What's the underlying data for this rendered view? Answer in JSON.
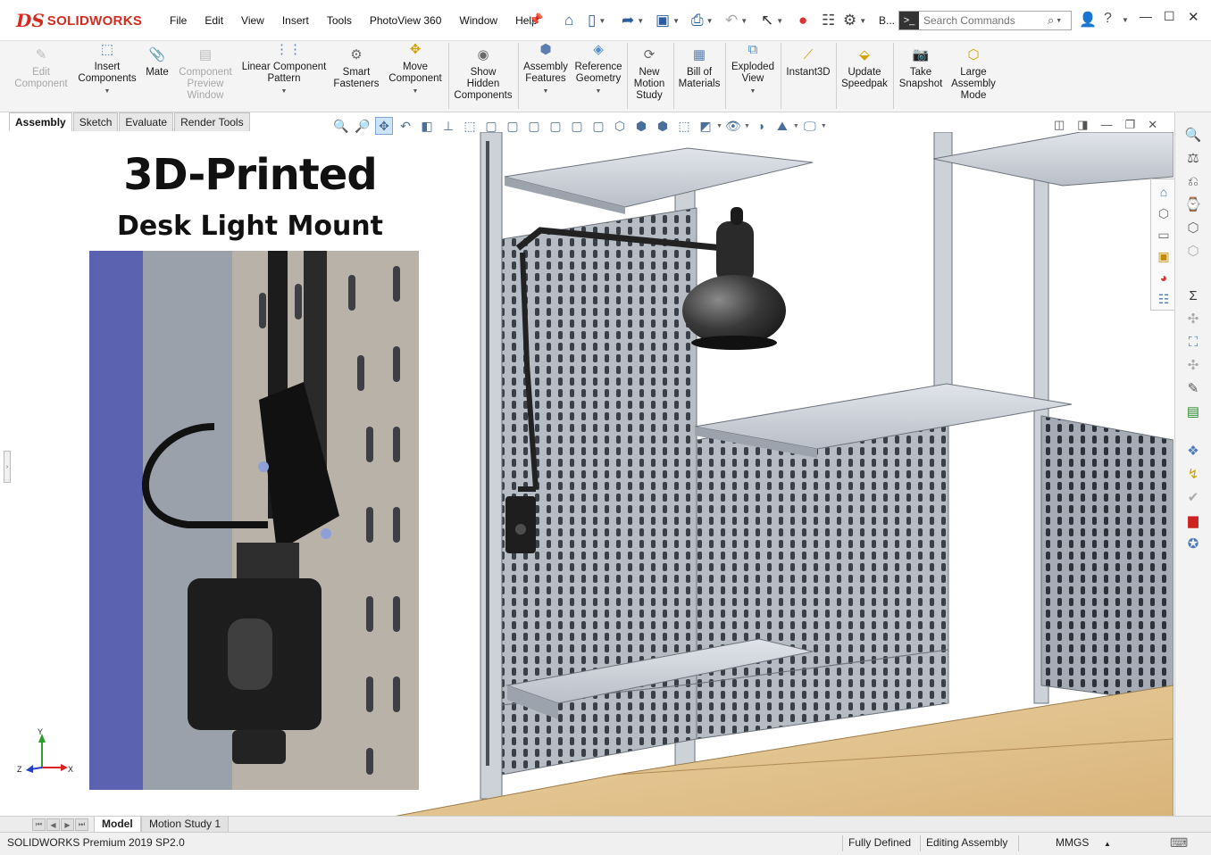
{
  "app": {
    "brand_ds": "DS",
    "brand_name": "SOLIDWORKS"
  },
  "menu": [
    "File",
    "Edit",
    "View",
    "Insert",
    "Tools",
    "PhotoView 360",
    "Window",
    "Help"
  ],
  "quick_access": {
    "overflow_label": "B...",
    "icons": [
      "home-icon",
      "new-document-icon",
      "open-icon",
      "save-icon",
      "print-icon",
      "undo-icon",
      "select-icon",
      "rebuild-icon",
      "file-properties-icon",
      "options-icon"
    ]
  },
  "search": {
    "placeholder": "Search Commands"
  },
  "ribbon": {
    "commands": [
      {
        "id": "edit-component",
        "label": [
          "Edit",
          "Component"
        ],
        "enabled": false,
        "dropdown": false
      },
      {
        "id": "insert-components",
        "label": [
          "Insert",
          "Components"
        ],
        "enabled": true,
        "dropdown": true
      },
      {
        "id": "mate",
        "label": [
          "Mate"
        ],
        "enabled": true,
        "dropdown": false
      },
      {
        "id": "component-preview-window",
        "label": [
          "Component",
          "Preview",
          "Window"
        ],
        "enabled": false,
        "dropdown": false
      },
      {
        "id": "linear-component-pattern",
        "label": [
          "Linear Component",
          "Pattern"
        ],
        "enabled": true,
        "dropdown": true
      },
      {
        "id": "smart-fasteners",
        "label": [
          "Smart",
          "Fasteners"
        ],
        "enabled": true,
        "dropdown": false
      },
      {
        "id": "move-component",
        "label": [
          "Move",
          "Component"
        ],
        "enabled": true,
        "dropdown": true
      },
      {
        "id": "show-hidden-components",
        "label": [
          "Show",
          "Hidden",
          "Components"
        ],
        "enabled": true,
        "dropdown": false
      },
      {
        "id": "assembly-features",
        "label": [
          "Assembly",
          "Features"
        ],
        "enabled": true,
        "dropdown": true
      },
      {
        "id": "reference-geometry",
        "label": [
          "Reference",
          "Geometry"
        ],
        "enabled": true,
        "dropdown": true
      },
      {
        "id": "new-motion-study",
        "label": [
          "New",
          "Motion",
          "Study"
        ],
        "enabled": true,
        "dropdown": false
      },
      {
        "id": "bill-of-materials",
        "label": [
          "Bill of",
          "Materials"
        ],
        "enabled": true,
        "dropdown": false
      },
      {
        "id": "exploded-view",
        "label": [
          "Exploded",
          "View"
        ],
        "enabled": true,
        "dropdown": true
      },
      {
        "id": "instant3d",
        "label": [
          "Instant3D"
        ],
        "enabled": true,
        "dropdown": false
      },
      {
        "id": "update-speedpak",
        "label": [
          "Update",
          "Speedpak"
        ],
        "enabled": true,
        "dropdown": false
      },
      {
        "id": "take-snapshot",
        "label": [
          "Take",
          "Snapshot"
        ],
        "enabled": true,
        "dropdown": false
      },
      {
        "id": "large-assembly-mode",
        "label": [
          "Large",
          "Assembly",
          "Mode"
        ],
        "enabled": true,
        "dropdown": false
      }
    ]
  },
  "tabs": [
    {
      "label": "Assembly",
      "active": true
    },
    {
      "label": "Sketch",
      "active": false
    },
    {
      "label": "Evaluate",
      "active": false
    },
    {
      "label": "Render Tools",
      "active": false
    }
  ],
  "graphics": {
    "title": "3D-Printed",
    "subtitle": "Desk Light Mount",
    "triad_labels": [
      "Y",
      "Z",
      "X"
    ]
  },
  "bottom_tabs": {
    "model": "Model",
    "motion": "Motion Study 1"
  },
  "status": {
    "product": "SOLIDWORKS Premium 2019 SP2.0",
    "state": "Fully Defined",
    "mode": "Editing Assembly",
    "units": "MMGS",
    "units_arrow": "▲"
  },
  "colors": {
    "brand": "#d52b1e",
    "viewport_bg": "#ffffff",
    "panel_gray": "#9aa0a8",
    "wood": "#e8c993",
    "lamp": "#2a2a2a"
  }
}
